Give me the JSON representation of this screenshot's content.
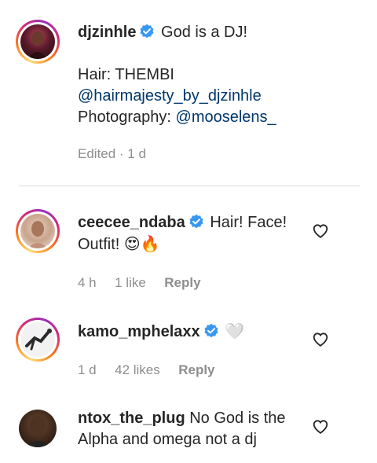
{
  "comments": [
    {
      "username": "djzinhle",
      "verified": true,
      "text": "God is a DJ!",
      "hair_label": "Hair: THEMBI",
      "hair_mention": "@hairmajesty_by_djzinhle",
      "photo_label": "Photography: ",
      "photo_mention": "@mooselens_",
      "meta": "Edited · 1 d"
    },
    {
      "username": "ceecee_ndaba",
      "verified": true,
      "text_line1": "Hair! Face!",
      "text_line2": "Outfit!",
      "emojis": "😍🔥",
      "time": "4 h",
      "likes": "1 like",
      "reply": "Reply"
    },
    {
      "username": "kamo_mphelaxx",
      "verified": true,
      "emoji": "🤍",
      "time": "1 d",
      "likes": "42 likes",
      "reply": "Reply"
    },
    {
      "username": "ntox_the_plug",
      "verified": false,
      "text_line1": "No God is the",
      "text_line2": "Alpha and omega not a dj"
    }
  ],
  "colors": {
    "verified": "#3897f0",
    "mention": "#00376b",
    "meta": "#8e8e8e"
  }
}
